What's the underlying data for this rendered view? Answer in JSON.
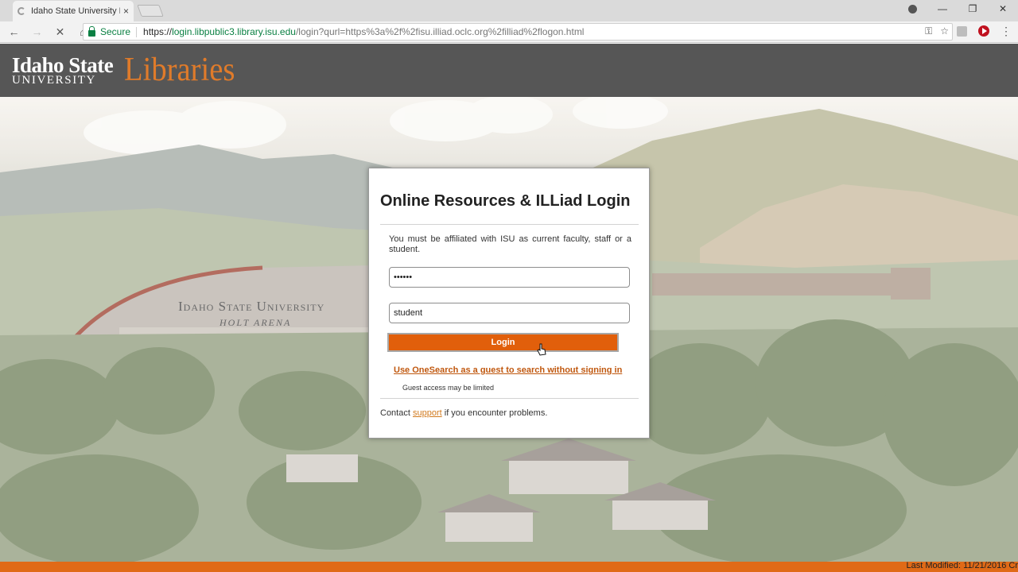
{
  "browser": {
    "tab_title": "Idaho State University Lib",
    "tab_close": "×",
    "window_controls": {
      "minimize": "—",
      "restore": "❐",
      "close": "✕"
    },
    "nav": {
      "back": "←",
      "forward": "→",
      "stop": "✕",
      "home": "⌂"
    },
    "secure_label": "Secure",
    "url": {
      "scheme": "https://",
      "host": "login.libpublic3.library.isu.edu",
      "path": "/login?qurl=https%3a%2f%2fisu.illiad.oclc.org%2filliad%2flogon.html"
    },
    "omnibox_icons": {
      "key": "⚿",
      "star": "☆"
    },
    "menu": "⋮"
  },
  "header": {
    "logo_line1": "Idaho State",
    "logo_line2": "UNIVERSITY",
    "logo_libraries": "Libraries"
  },
  "scene": {
    "arena_title": "Idaho State University",
    "arena_sub": "HOLT ARENA"
  },
  "login": {
    "title": "Online Resources & ILLiad Login",
    "notice": "You must be affiliated with ISU as current faculty, staff or a student.",
    "password_value": "••••••",
    "username_value": "student",
    "login_button": "Login",
    "guest_link": "Use OneSearch as a guest to search without signing in",
    "guest_note": "Guest access may be limited",
    "contact_prefix": "Contact",
    "contact_link": "support",
    "contact_suffix": "if you encounter problems."
  },
  "footer": {
    "last_modified": "Last Modified: 11/21/2016 Cr"
  },
  "colors": {
    "accent_orange": "#e15f0b",
    "header_grey": "#565656",
    "secure_green": "#0b8043"
  }
}
